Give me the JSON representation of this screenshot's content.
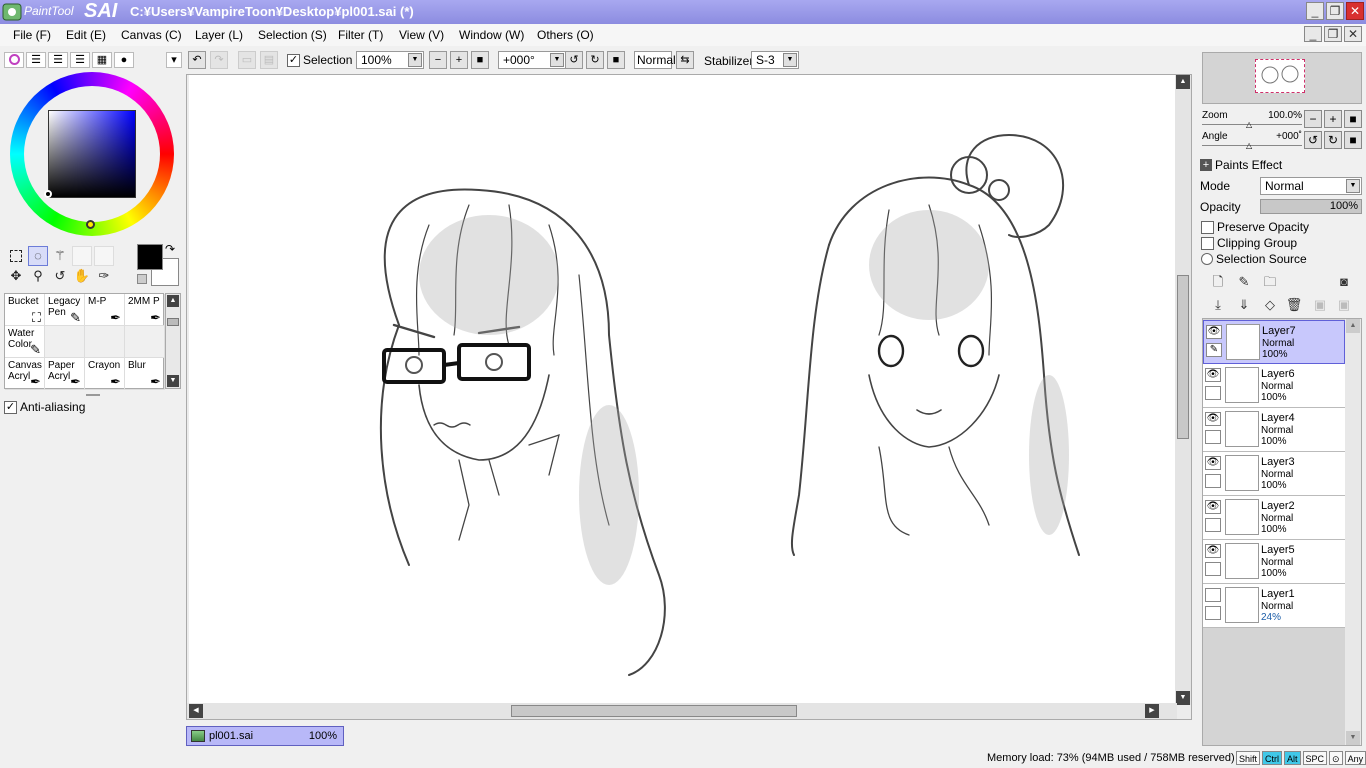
{
  "app": {
    "logo_text": "PaintTool",
    "logo_bold": "SAI",
    "title": "C:¥Users¥VampireToon¥Desktop¥pl001.sai (*)"
  },
  "window_controls": {
    "minimize": "_",
    "restore": "❐",
    "close": "✕"
  },
  "menu": [
    {
      "label": "File (F)"
    },
    {
      "label": "Edit (E)"
    },
    {
      "label": "Canvas (C)"
    },
    {
      "label": "Layer (L)"
    },
    {
      "label": "Selection (S)"
    },
    {
      "label": "Filter (T)"
    },
    {
      "label": "View (V)"
    },
    {
      "label": "Window (W)"
    },
    {
      "label": "Others (O)"
    }
  ],
  "toolbar": {
    "selection_label": "Selection",
    "selection_checked": true,
    "zoom": "100%",
    "angle": "+000°",
    "blend": "Normal",
    "stabilizer_label": "Stabilizer",
    "stabilizer": "S-3"
  },
  "tools": {
    "selection_tools": [
      "marquee-icon",
      "lasso-icon",
      "magic-wand-icon",
      "blank",
      "blank"
    ],
    "nav_tools": [
      "move-icon",
      "zoom-icon",
      "rotate-icon",
      "hand-icon",
      "eyedropper-icon"
    ],
    "foreground_color": "#000000",
    "background_color": "#ffffff"
  },
  "brushes": [
    {
      "name": "Bucket"
    },
    {
      "name": "Legacy Pen"
    },
    {
      "name": "M-P"
    },
    {
      "name": "2MM P"
    },
    {
      "name": "Water Color"
    },
    {
      "name": ""
    },
    {
      "name": ""
    },
    {
      "name": ""
    },
    {
      "name": "Canvas Acryl"
    },
    {
      "name": "Paper Acryl"
    },
    {
      "name": "Crayon"
    },
    {
      "name": "Blur"
    }
  ],
  "anti_aliasing": {
    "label": "Anti-aliasing",
    "checked": true
  },
  "document_tab": {
    "name": "pl001.sai",
    "zoom": "100%"
  },
  "navigator": {
    "zoom_label": "Zoom",
    "zoom_value": "100.0%",
    "angle_label": "Angle",
    "angle_value": "+000˚"
  },
  "layer_props": {
    "paints_effect": "Paints Effect",
    "mode_label": "Mode",
    "mode_value": "Normal",
    "opacity_label": "Opacity",
    "opacity_value": "100%",
    "preserve_opacity": "Preserve Opacity",
    "clipping_group": "Clipping Group",
    "selection_source": "Selection Source"
  },
  "layers": [
    {
      "name": "Layer7",
      "mode": "Normal",
      "opacity": "100%",
      "visible": true,
      "selected": true
    },
    {
      "name": "Layer6",
      "mode": "Normal",
      "opacity": "100%",
      "visible": true,
      "selected": false
    },
    {
      "name": "Layer4",
      "mode": "Normal",
      "opacity": "100%",
      "visible": true,
      "selected": false
    },
    {
      "name": "Layer3",
      "mode": "Normal",
      "opacity": "100%",
      "visible": true,
      "selected": false
    },
    {
      "name": "Layer2",
      "mode": "Normal",
      "opacity": "100%",
      "visible": true,
      "selected": false
    },
    {
      "name": "Layer5",
      "mode": "Normal",
      "opacity": "100%",
      "visible": true,
      "selected": false
    },
    {
      "name": "Layer1",
      "mode": "Normal",
      "opacity": "24%",
      "visible": false,
      "selected": false
    }
  ],
  "status": {
    "memory": "Memory load: 73% (94MB used / 758MB reserved)",
    "keys": [
      {
        "label": "Shift",
        "on": false
      },
      {
        "label": "Ctrl",
        "on": true
      },
      {
        "label": "Alt",
        "on": true
      },
      {
        "label": "SPC",
        "on": false
      },
      {
        "label": "⊙",
        "on": false
      },
      {
        "label": "Any",
        "on": false
      },
      {
        "label": "✎",
        "on": false
      }
    ]
  },
  "colors": {
    "title_bar": "#9b9bea",
    "selected_layer": "#c8c8fc",
    "doc_tab": "#b8b8f8"
  }
}
